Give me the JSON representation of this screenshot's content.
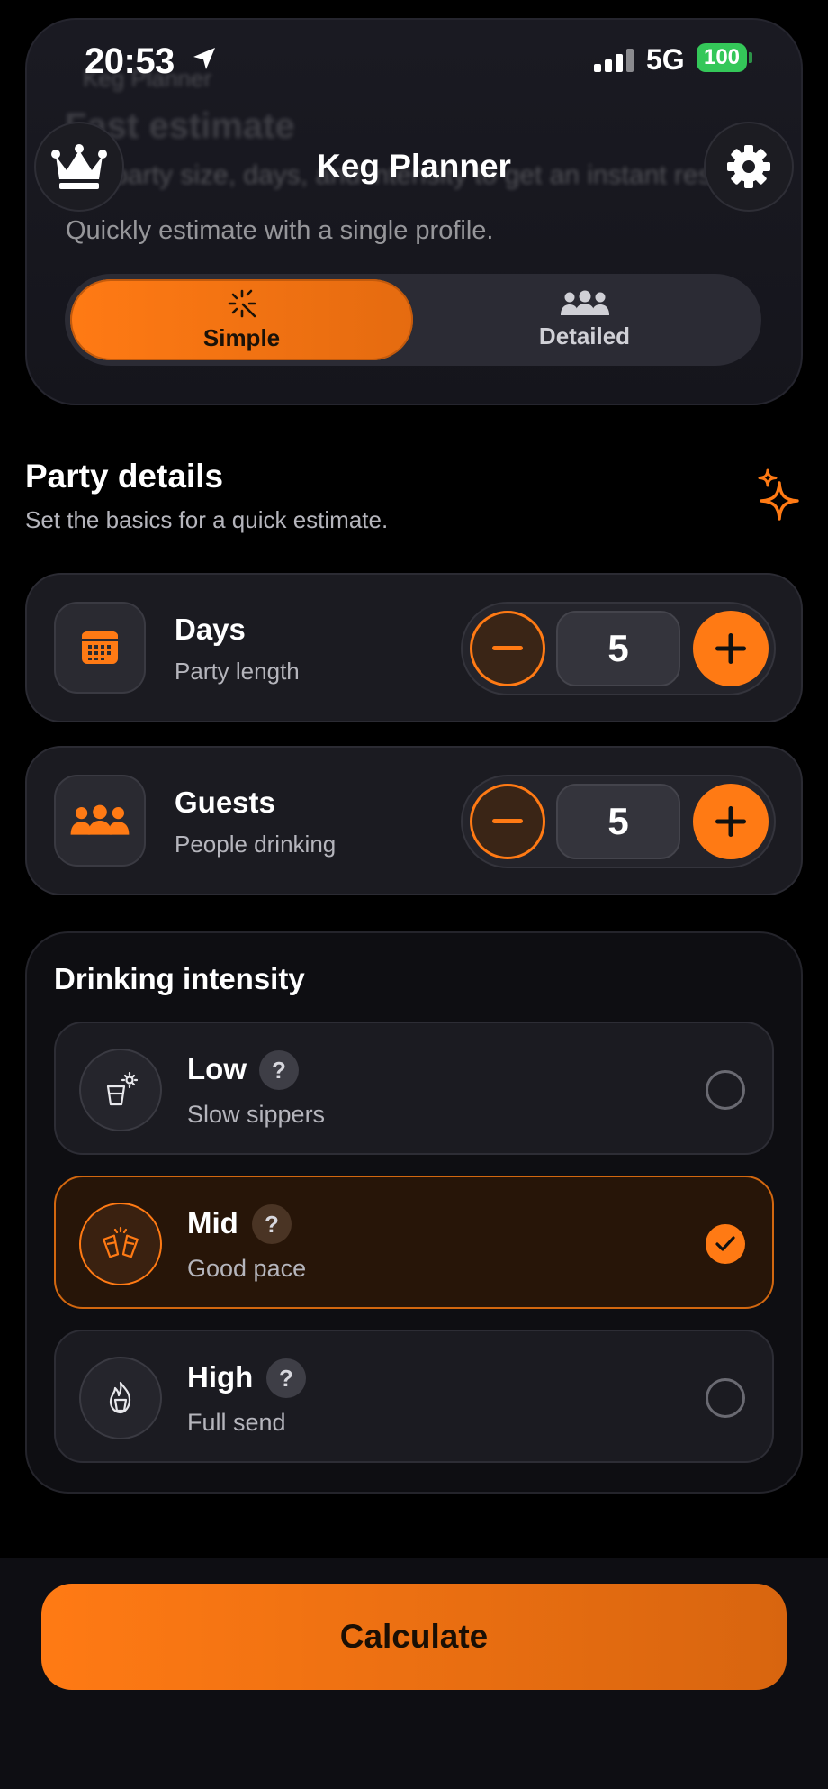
{
  "status": {
    "time": "20:53",
    "network": "5G",
    "battery": "100"
  },
  "header": {
    "title": "Keg Planner"
  },
  "hero": {
    "ghost_breadcrumb": "Keg Planner",
    "ghost_title": "Fast estimate",
    "ghost_desc": "Set party size, days, and intensity to get an instant result.",
    "description": "Quickly estimate with a single profile.",
    "modes": [
      {
        "label": "Simple",
        "icon": "magic-wand-icon",
        "active": true
      },
      {
        "label": "Detailed",
        "icon": "group-icon",
        "active": false
      }
    ]
  },
  "party": {
    "title": "Party details",
    "subtitle": "Set the basics for a quick estimate.",
    "rows": [
      {
        "title": "Days",
        "subtitle": "Party length",
        "value": "5",
        "icon": "calendar-icon"
      },
      {
        "title": "Guests",
        "subtitle": "People drinking",
        "value": "5",
        "icon": "group-icon"
      }
    ]
  },
  "intensity": {
    "title": "Drinking intensity",
    "options": [
      {
        "title": "Low",
        "subtitle": "Slow sippers",
        "help": "?",
        "icon": "cup-icon",
        "selected": false
      },
      {
        "title": "Mid",
        "subtitle": "Good pace",
        "help": "?",
        "icon": "cheers-icon",
        "selected": true
      },
      {
        "title": "High",
        "subtitle": "Full send",
        "help": "?",
        "icon": "fire-cup-icon",
        "selected": false
      }
    ]
  },
  "actions": {
    "calculate": "Calculate"
  },
  "colors": {
    "accent": "#ff7a14",
    "background": "#000000",
    "card": "#1b1b21"
  }
}
